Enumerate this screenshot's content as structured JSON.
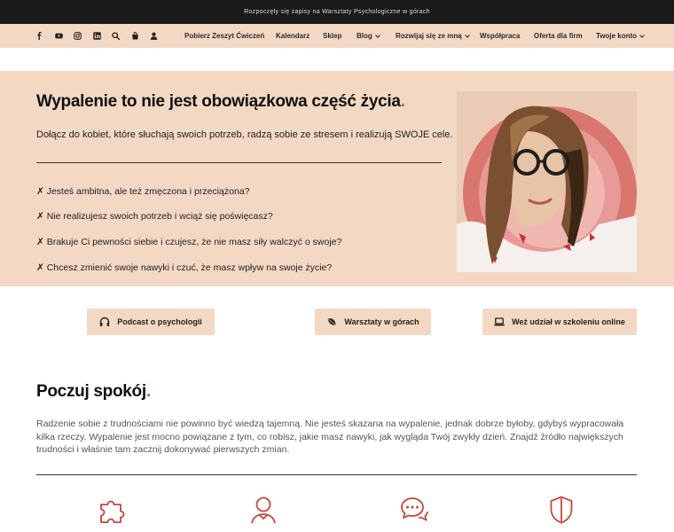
{
  "announcement": "Rozpoczęły się zapisy na Warsztaty Psychologiczne w górach",
  "social_icons": [
    "facebook-icon",
    "youtube-icon",
    "instagram-icon",
    "linkedin-icon",
    "search-icon",
    "bag-icon",
    "user-icon"
  ],
  "nav": {
    "items": [
      {
        "label": "Pobierz Zeszyt Ćwiczeń"
      },
      {
        "label": "Kalendarz"
      },
      {
        "label": "Sklep"
      },
      {
        "label": "Blog"
      },
      {
        "label": "Rozwijaj się ze mną"
      },
      {
        "label": "Współpraca"
      },
      {
        "label": "Oferta dla firm"
      },
      {
        "label": "Twoje konto"
      }
    ]
  },
  "hero": {
    "title": "Wypalenie to nie jest obowiązkowa część życia",
    "title_dot": ".",
    "subtitle": "Dołącz do kobiet, które słuchają swoich potrzeb, radzą sobie ze stresem i realizują SWOJE cele.",
    "bullets": [
      "✗ Jesteś ambitna, ale też zmęczona i przeciążona?",
      "✗ Nie realizujesz swoich potrzeb i wciąż się poświęcasz?",
      "✗ Brakuje Ci pewności siebie i czujesz, że nie masz siły walczyć o swoje?",
      "✗ Chcesz zmienić swoje nawyki i czuć, że masz wpływ na swoje życie?"
    ]
  },
  "buttons": [
    {
      "label": "Podcast o psychologii",
      "icon": "headphones-icon"
    },
    {
      "label": "Warsztaty w górach",
      "icon": "leaf-icon"
    },
    {
      "label": "Weź udział w szkoleniu online",
      "icon": "laptop-icon"
    }
  ],
  "section": {
    "title": "Poczuj spokój",
    "title_dot": ".",
    "paragraph": "Radzenie sobie z trudnościami nie powinno być wiedzą tajemną. Nie jesteś skazana na wypalenie, jednak dobrze byłoby, gdybyś wypracowała kilka rzeczy. Wypalenie jest mocno powiązane z tym, co robisz, jakie masz nawyki, jak wygląda Twój zwykły dzień. Znajdź źródło największych trudności i właśnie tam zacznij dokonywać pierwszych zmian."
  },
  "feature_icons": [
    "puzzle-icon",
    "person-icon",
    "chat-bubbles-icon",
    "shield-icon"
  ],
  "colors": {
    "accent": "#d05a3c",
    "peach": "#f3d8c4",
    "topbar": "#1a1a1a"
  }
}
